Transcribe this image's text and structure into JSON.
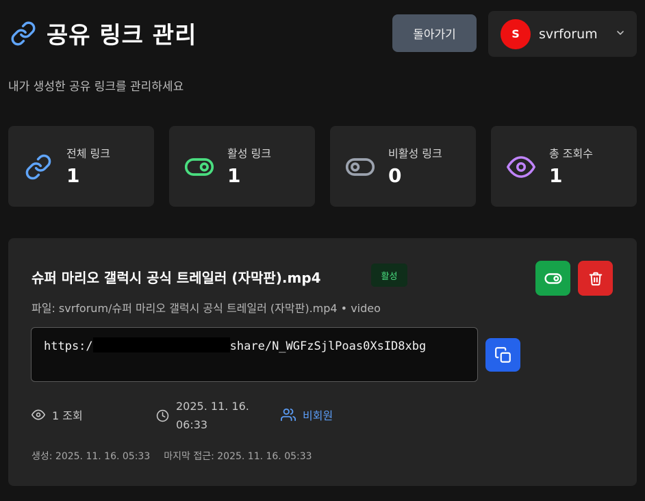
{
  "header": {
    "title": "공유 링크 관리",
    "back_label": "돌아가기",
    "user": {
      "initial": "S",
      "name": "svrforum"
    }
  },
  "subtitle": "내가 생성한 공유 링크를 관리하세요",
  "stats": [
    {
      "label": "전체 링크",
      "value": "1",
      "icon": "link-icon",
      "color": "#60a5fa"
    },
    {
      "label": "활성 링크",
      "value": "1",
      "icon": "toggle-on-icon",
      "color": "#4ade80"
    },
    {
      "label": "비활성 링크",
      "value": "0",
      "icon": "toggle-off-icon",
      "color": "#9ca3af"
    },
    {
      "label": "총 조회수",
      "value": "1",
      "icon": "eye-icon",
      "color": "#c084fc"
    }
  ],
  "link": {
    "title": "슈퍼 마리오 갤럭시 공식 트레일러 (자막판).mp4",
    "status": "활성",
    "file_info": "파일: svrforum/슈퍼 마리오 갤럭시 공식 트레일러 (자막판).mp4 • video",
    "url_prefix": "https:/",
    "url_suffix": "share/N_WGFzSjlPoas0XsID8xbg",
    "views": "1 조회",
    "expires_line1": "2025. 11. 16.",
    "expires_line2": "06:33",
    "access": "비회원",
    "created": "생성: 2025. 11. 16. 05:33",
    "last_access": "마지막 접근: 2025. 11. 16. 05:33"
  },
  "colors": {
    "background": "#141414",
    "card": "#252525",
    "accent_green": "#16a34a",
    "accent_red": "#dc2626",
    "accent_blue": "#2563eb"
  }
}
